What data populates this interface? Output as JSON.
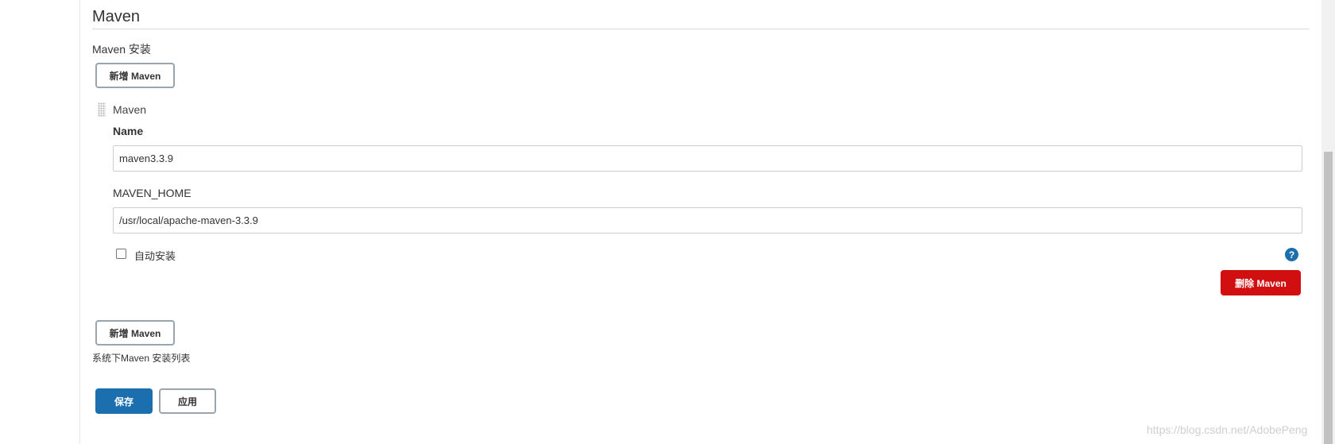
{
  "section": {
    "title": "Maven",
    "install_label": "Maven 安装"
  },
  "buttons": {
    "add_maven": "新增 Maven",
    "delete_maven": "删除 Maven",
    "save": "保存",
    "apply": "应用"
  },
  "installation": {
    "header": "Maven",
    "name_label": "Name",
    "name_value": "maven3.3.9",
    "home_label": "MAVEN_HOME",
    "home_value": "/usr/local/apache-maven-3.3.9",
    "auto_install_label": "自动安装",
    "help_icon": "question-mark-icon"
  },
  "description": "系统下Maven 安装列表",
  "watermark": "https://blog.csdn.net/AdobePeng",
  "colors": {
    "primary": "#1b6fae",
    "danger": "#d10f10",
    "border": "#9aa4ad"
  }
}
